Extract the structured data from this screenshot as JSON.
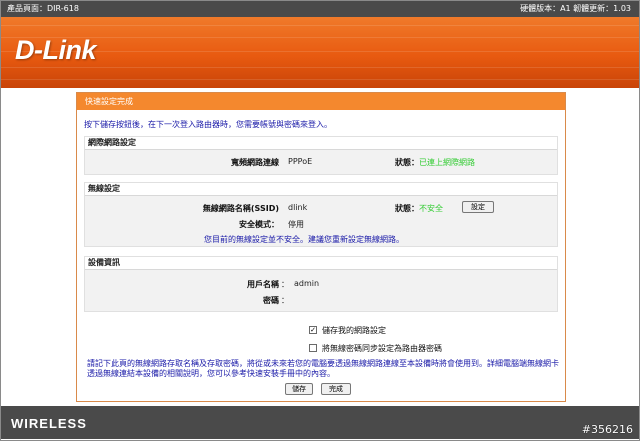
{
  "header": {
    "product": "產品頁面：DIR-618",
    "versions": "硬體版本：A1   韌體更新：1.03"
  },
  "brand": {
    "logo": "D-Link",
    "footer": "WIRELESS"
  },
  "panel": {
    "title": "快速設定完成",
    "intro": "按下儲存按鈕後，在下一次登入路由器時，您需要帳號與密碼來登入。"
  },
  "network": {
    "heading": "網際網路設定",
    "conn_label": "寬頻網路連線",
    "conn_value": "PPPoE",
    "status_label": "狀態：",
    "status_value": "已連上網際網路"
  },
  "wireless": {
    "heading": "無線設定",
    "ssid_label": "無線網路名稱(SSID)",
    "ssid_value": "dlink",
    "security_label": "安全模式：",
    "security_value": "停用",
    "status_label": "狀態：",
    "status_value": "不安全",
    "setup_button": "設定",
    "warning": "您目前的無線設定並不安全。建議您重新設定無線網路。"
  },
  "device": {
    "heading": "設備資訊",
    "user_label": "用戶名稱",
    "user_value": "admin",
    "password_label": "密碼",
    "password_value": ""
  },
  "options": {
    "save_settings": {
      "label": "儲存我的網路設定",
      "checked": "✓"
    },
    "sync_password": {
      "label": "將無線密碼同步設定為路由器密碼",
      "checked": ""
    }
  },
  "note": "請記下此頁的無線網路存取名稱及存取密碼，將從或未來若您的電腦要透過無線網路連線至本設備時將會使用到。詳細電腦端無線網卡透過無線連結本設備的相關說明，您可以參考快速安裝手冊中的內容。",
  "buttons": {
    "save": "儲存",
    "finish": "完成"
  },
  "watermark": "#356216",
  "colors": {
    "brand_orange": "#e85a10",
    "panel_header": "#f4882e",
    "status_green": "#33cc33",
    "note_blue": "#1a1aa8",
    "bar_gray": "#4a4a4a"
  }
}
